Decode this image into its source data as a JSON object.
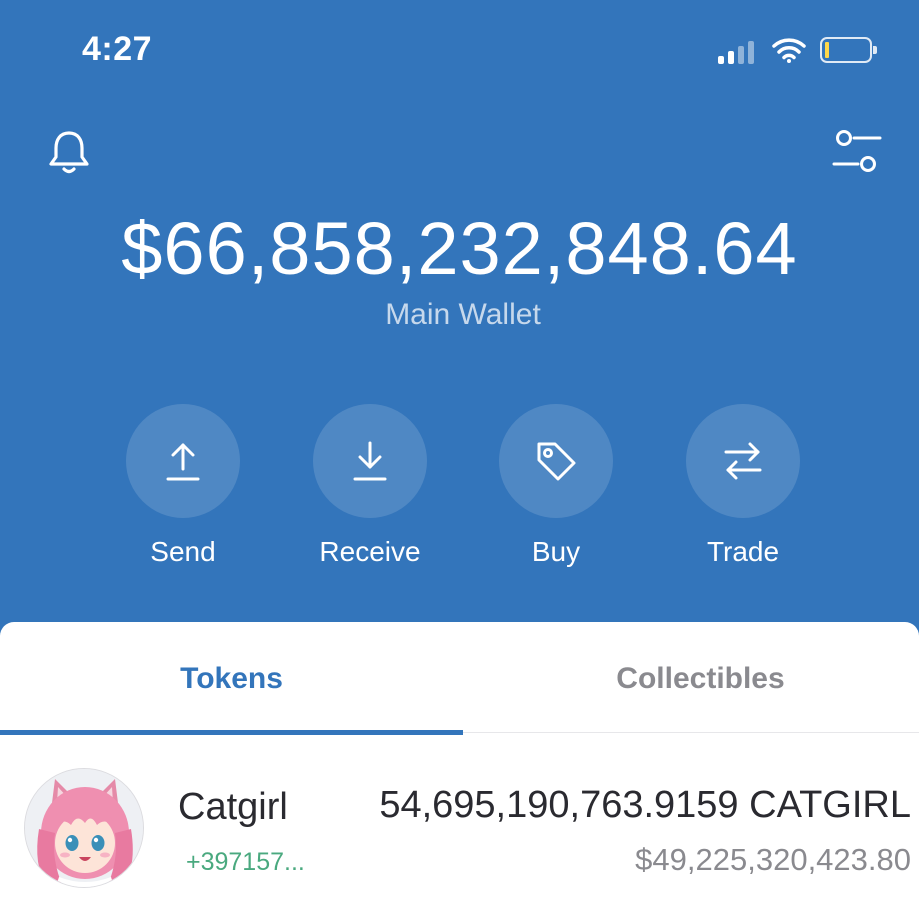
{
  "status_bar": {
    "time": "4:27"
  },
  "wallet": {
    "balance": "$66,858,232,848.64",
    "name": "Main Wallet"
  },
  "actions": [
    {
      "label": "Send",
      "icon": "upload-arrow-icon"
    },
    {
      "label": "Receive",
      "icon": "download-arrow-icon"
    },
    {
      "label": "Buy",
      "icon": "tag-icon"
    },
    {
      "label": "Trade",
      "icon": "swap-arrows-icon"
    }
  ],
  "tabs": {
    "tokens": "Tokens",
    "collectibles": "Collectibles",
    "active": "Tokens"
  },
  "tokens": [
    {
      "name": "Catgirl",
      "change": "+397157...",
      "amount": "54,695,190,763.9159 CATGIRL",
      "fiat": "$49,225,320,423.80",
      "icon": "catgirl-avatar"
    }
  ],
  "colors": {
    "header_blue": "#3375bb",
    "positive_green": "#4aa97f",
    "muted_gray": "#8a8a8f"
  }
}
